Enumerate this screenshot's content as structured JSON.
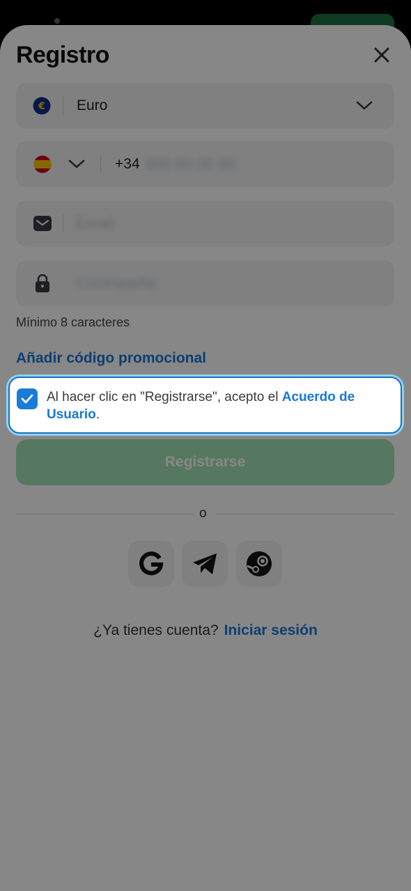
{
  "modal": {
    "title": "Registro",
    "close_icon": "close-icon"
  },
  "currency": {
    "value": "Euro",
    "icon": "euro-coin-icon",
    "dropdown_icon": "chevron-down-icon"
  },
  "phone": {
    "country_flag": "spain-flag-icon",
    "country_code": "+34",
    "placeholder": "000 00 00 00"
  },
  "email": {
    "icon": "envelope-icon",
    "placeholder": "Email"
  },
  "password": {
    "icon": "lock-icon",
    "placeholder": "Contraseña",
    "hint": "Mínimo 8 caracteres"
  },
  "promo": {
    "label": "Añadir código promocional"
  },
  "agreement": {
    "checked": true,
    "text_before": "Al hacer clic en \"Registrarse\", acepto el ",
    "link": "Acuerdo de Usuario",
    "text_after": "."
  },
  "register_button": {
    "label": "Registrarse"
  },
  "divider": {
    "label": "o"
  },
  "social": [
    {
      "name": "google-icon"
    },
    {
      "name": "telegram-icon"
    },
    {
      "name": "steam-icon"
    }
  ],
  "login_prompt": {
    "question": "¿Ya tienes cuenta?",
    "link": "Iniciar sesión"
  },
  "colors": {
    "accent": "#1a78d6",
    "register_green": "#a3e3b5",
    "field_bg": "#f1f2f4"
  }
}
